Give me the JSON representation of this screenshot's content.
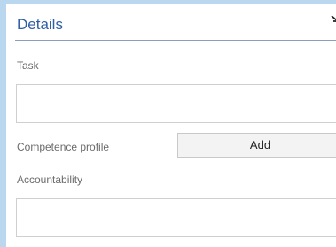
{
  "details": {
    "title": "Details",
    "task": {
      "label": "Task",
      "value": ""
    },
    "competence_profile": {
      "label": "Competence profile",
      "add_label": "Add"
    },
    "accountability": {
      "label": "Accountability",
      "value": ""
    }
  },
  "icons": {
    "collapse": "collapse-corner-icon"
  }
}
